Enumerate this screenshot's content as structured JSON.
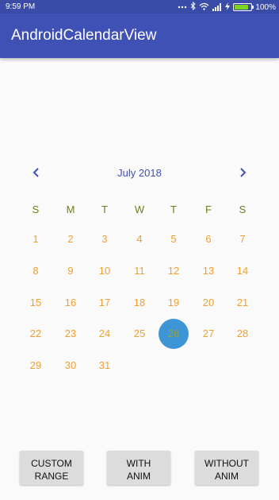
{
  "status_bar": {
    "time": "9:59 PM",
    "battery_text": "100%",
    "icons": [
      "dots-icon",
      "bluetooth-icon",
      "wifi-icon",
      "signal-icon",
      "charging-icon",
      "battery-icon"
    ]
  },
  "app_bar": {
    "title": "AndroidCalendarView",
    "color": "#3f51b5"
  },
  "calendar": {
    "month_label": "July 2018",
    "prev_icon": "chevron-left-icon",
    "next_icon": "chevron-right-icon",
    "weekdays": [
      "S",
      "M",
      "T",
      "W",
      "T",
      "F",
      "S"
    ],
    "weeks": [
      [
        "1",
        "2",
        "3",
        "4",
        "5",
        "6",
        "7"
      ],
      [
        "8",
        "9",
        "10",
        "11",
        "12",
        "13",
        "14"
      ],
      [
        "15",
        "16",
        "17",
        "18",
        "19",
        "20",
        "21"
      ],
      [
        "22",
        "23",
        "24",
        "25",
        "26",
        "27",
        "28"
      ],
      [
        "29",
        "30",
        "31"
      ]
    ],
    "selected_day": "26",
    "colors": {
      "weekday": "#6b7f1a",
      "day": "#f0a030",
      "selection": "#3d95d6"
    }
  },
  "buttons": [
    {
      "line1": "CUSTOM",
      "line2": "RANGE"
    },
    {
      "line1": "WITH",
      "line2": "ANIM"
    },
    {
      "line1": "WITHOUT",
      "line2": "ANIM"
    }
  ]
}
